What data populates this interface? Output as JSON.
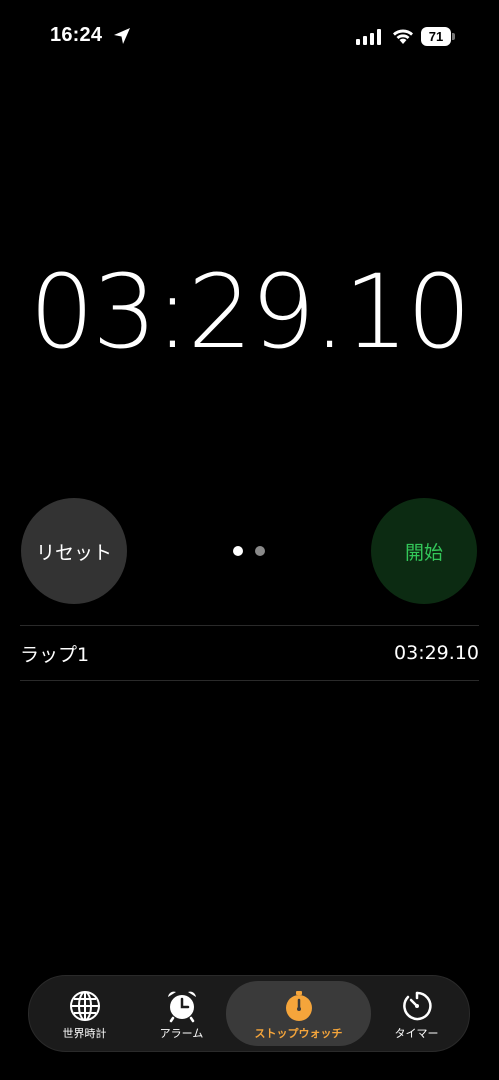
{
  "status_bar": {
    "time": "16:24",
    "battery": "71",
    "location_icon": "location-arrow-icon",
    "signal_icon": "cellular-signal-icon",
    "wifi_icon": "wifi-icon"
  },
  "stopwatch": {
    "display": "03:29.10",
    "reset_label": "リセット",
    "start_label": "開始",
    "start_color": "#33c759",
    "page_count": 2,
    "active_page": 1
  },
  "laps": [
    {
      "label": "ラップ1",
      "time": "03:29.10"
    }
  ],
  "tabs": [
    {
      "label": "世界時計",
      "icon": "globe-icon",
      "active": false
    },
    {
      "label": "アラーム",
      "icon": "alarm-clock-icon",
      "active": false
    },
    {
      "label": "ストップウォッチ",
      "icon": "stopwatch-icon",
      "active": true
    },
    {
      "label": "タイマー",
      "icon": "timer-icon",
      "active": false
    }
  ],
  "colors": {
    "accent": "#f5a53b",
    "background": "#000000"
  }
}
